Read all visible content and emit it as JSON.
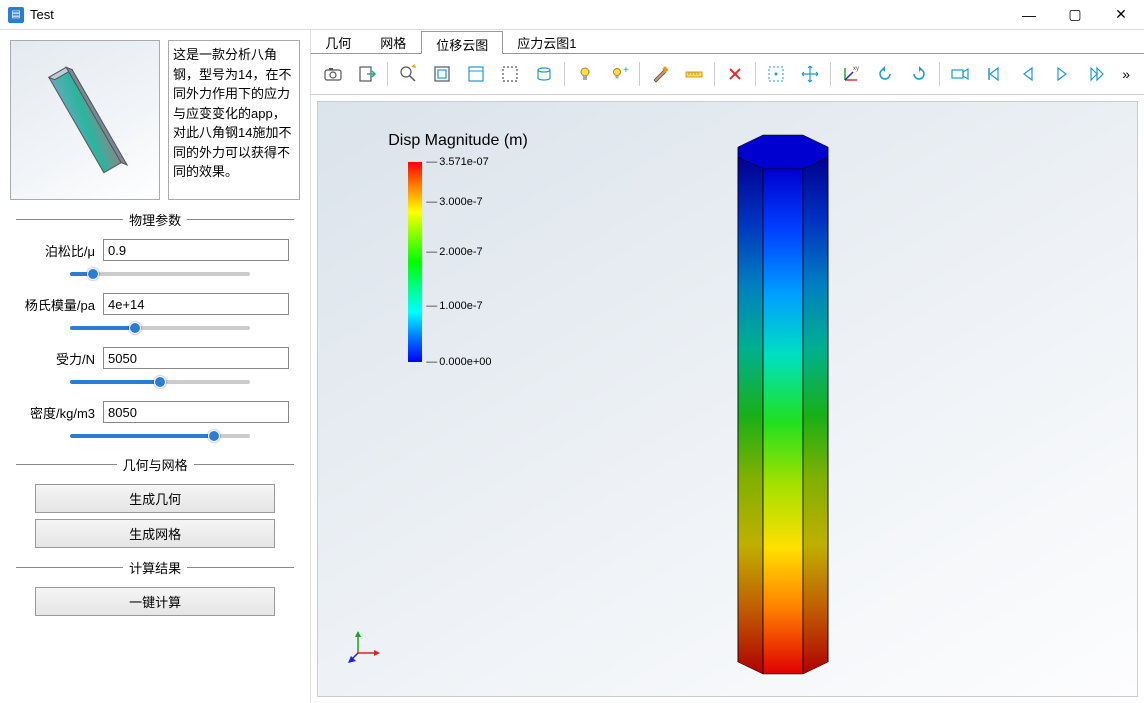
{
  "title": "Test",
  "description": "这是一款分析八角钢，型号为14，在不同外力作用下的应力与应变变化的app，对此八角钢14施加不同的外力可以获得不同的效果。",
  "sections": {
    "params": "物理参数",
    "geom": "几何与网格",
    "result": "计算结果"
  },
  "params": {
    "poisson": {
      "label": "泊松比/μ",
      "value": "0.9",
      "slider": 10
    },
    "young": {
      "label": "杨氏模量/pa",
      "value": "4e+14",
      "slider": 35
    },
    "force": {
      "label": "受力/N",
      "value": "5050",
      "slider": 50
    },
    "density": {
      "label": "密度/kg/m3",
      "value": "8050",
      "slider": 82
    }
  },
  "buttons": {
    "gen_geom": "生成几何",
    "gen_mesh": "生成网格",
    "compute": "一键计算"
  },
  "tabs": [
    "几何",
    "网格",
    "位移云图",
    "应力云图1"
  ],
  "active_tab": 2,
  "viewport": {
    "title": "Disp Magnitude (m)",
    "colorbar": {
      "ticks": [
        {
          "pos": 0,
          "label": "3.571e-07"
        },
        {
          "pos": 20,
          "label": "3.000e-7"
        },
        {
          "pos": 45,
          "label": "2.000e-7"
        },
        {
          "pos": 72,
          "label": "1.000e-7"
        },
        {
          "pos": 100,
          "label": "0.000e+00"
        }
      ]
    }
  },
  "toolbar_icons": [
    "camera",
    "export",
    "zoom",
    "zoom-extents",
    "fit-window",
    "select-box",
    "wireframe",
    "light",
    "light-add",
    "brush",
    "ruler",
    "delete",
    "select",
    "move",
    "axes",
    "rotate-ccw",
    "rotate-cw",
    "camera-video",
    "skip-back",
    "play-back",
    "play",
    "skip-forward"
  ]
}
